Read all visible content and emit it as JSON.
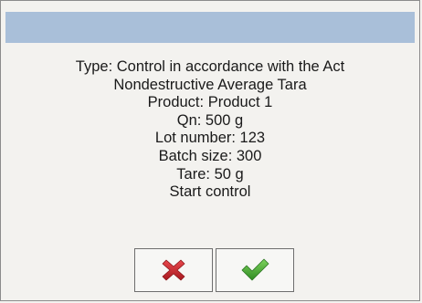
{
  "dialog": {
    "lines": [
      "Type: Control in accordance with the Act",
      "Nondestructive Average Tara",
      "Product: Product 1",
      "Qn: 500 g",
      "Lot number: 123",
      "Batch size: 300",
      "Tare: 50 g",
      "Start control"
    ]
  },
  "buttons": {
    "cancel_icon": "cross-icon",
    "confirm_icon": "checkmark-icon"
  },
  "colors": {
    "titlebar": "#a9bfd9",
    "cancel": "#c8262d",
    "confirm": "#3ea62f"
  }
}
